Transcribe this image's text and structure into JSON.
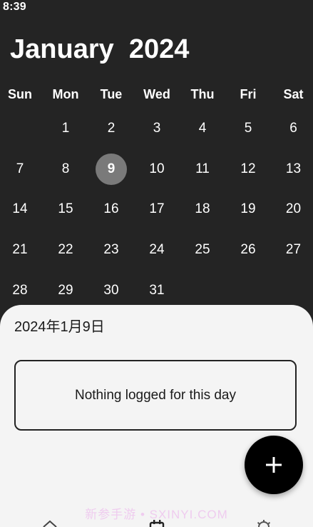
{
  "status_bar": {
    "time": "8:39"
  },
  "calendar": {
    "month_label": "January",
    "year_label": "2024",
    "weekdays": [
      "Sun",
      "Mon",
      "Tue",
      "Wed",
      "Thu",
      "Fri",
      "Sat"
    ],
    "weeks": [
      [
        "",
        "1",
        "2",
        "3",
        "4",
        "5",
        "6"
      ],
      [
        "7",
        "8",
        "9",
        "10",
        "11",
        "12",
        "13"
      ],
      [
        "14",
        "15",
        "16",
        "17",
        "18",
        "19",
        "20"
      ],
      [
        "21",
        "22",
        "23",
        "24",
        "25",
        "26",
        "27"
      ],
      [
        "28",
        "29",
        "30",
        "31",
        "",
        "",
        ""
      ]
    ],
    "selected_day": "9"
  },
  "sheet": {
    "date_label": "2024年1月9日",
    "empty_message": "Nothing logged for this day"
  },
  "fab": {
    "icon": "plus-icon"
  },
  "watermark": {
    "text": "新参手游 • SXINYI.COM"
  },
  "bottom_nav": {
    "items": [
      {
        "icon": "home-icon"
      },
      {
        "icon": "calendar-icon"
      },
      {
        "icon": "gear-icon"
      }
    ]
  },
  "colors": {
    "background": "#242424",
    "sheet": "#f4f4f4",
    "selected_day": "#7a7a7a",
    "fab": "#000000"
  }
}
